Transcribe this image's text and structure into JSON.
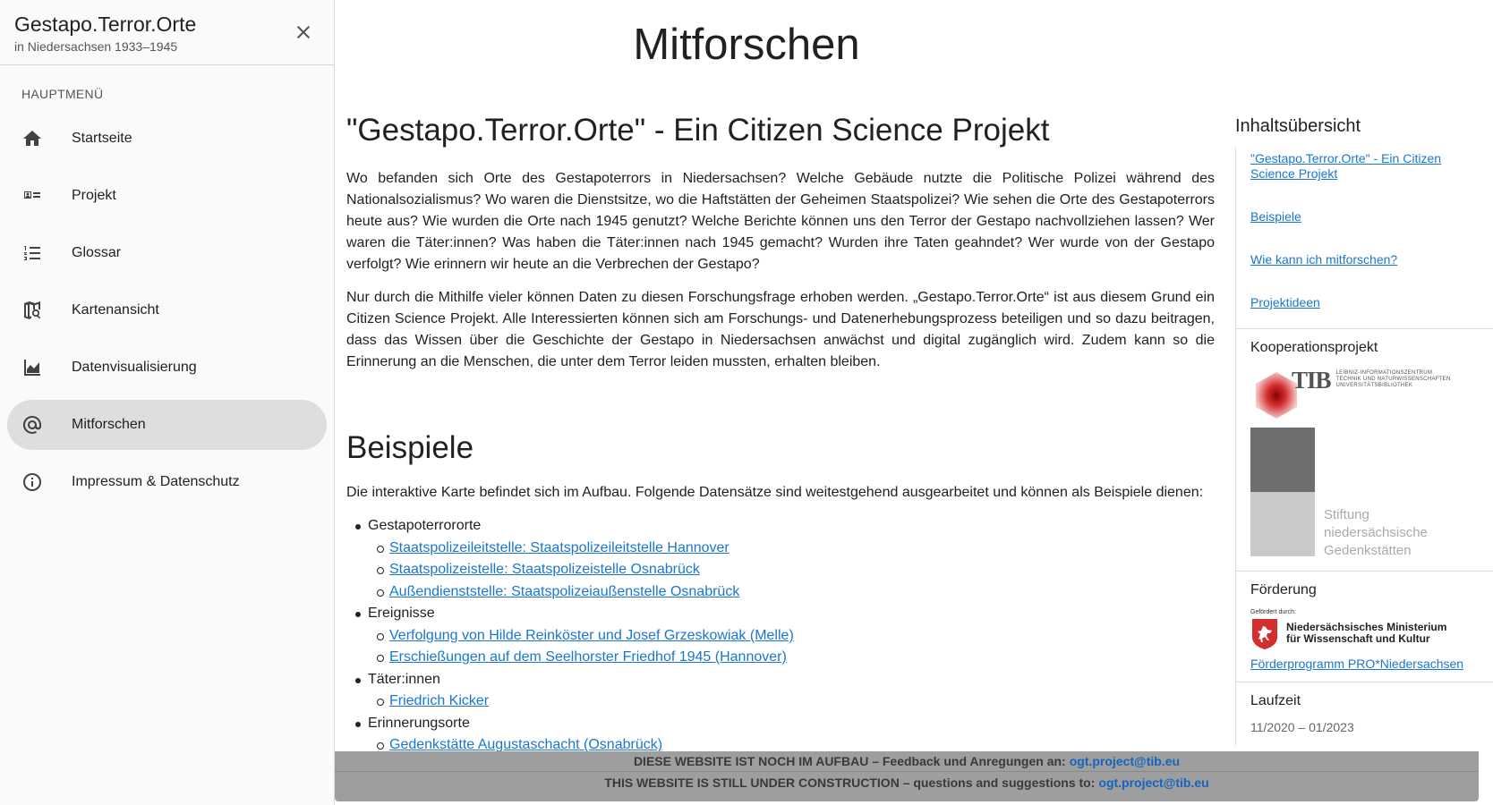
{
  "sidebar": {
    "title": "Gestapo.Terror.Orte",
    "subtitle": "in Niedersachsen 1933–1945",
    "menu_title": "HAUPTMENÜ",
    "items": [
      {
        "label": "Startseite",
        "icon": "home-icon"
      },
      {
        "label": "Projekt",
        "icon": "card-text-icon"
      },
      {
        "label": "Glossar",
        "icon": "numbered-list-icon"
      },
      {
        "label": "Kartenansicht",
        "icon": "map-search-icon"
      },
      {
        "label": "Datenvisualisierung",
        "icon": "area-chart-icon"
      },
      {
        "label": "Mitforschen",
        "icon": "at-sign-icon",
        "active": true
      },
      {
        "label": "Impressum & Datenschutz",
        "icon": "info-icon"
      }
    ]
  },
  "main": {
    "page_title": "Mitforschen",
    "section1": {
      "heading": "\"Gestapo.Terror.Orte\" - Ein Citizen Science Projekt",
      "p1": "Wo befanden sich Orte des Gestapoterrors in Niedersachsen? Welche Gebäude nutzte die Politische Polizei während des Nationalsozialismus? Wo waren die Dienstsitze, wo die Haftstätten der Geheimen Staatspolizei? Wie sehen die Orte des Gestapoterrors heute aus? Wie wurden die Orte nach 1945 genutzt? Welche Berichte können uns den Terror der Gestapo nachvollziehen lassen? Wer waren die Täter:innen? Was haben die Täter:innen nach 1945 gemacht? Wurden ihre Taten geahndet? Wer wurde von der Gestapo verfolgt? Wie erinnern wir heute an die Verbrechen der Gestapo?",
      "p2": "Nur durch die Mithilfe vieler können Daten zu diesen Forschungsfrage erhoben werden. „Gestapo.Terror.Orte“ ist aus diesem Grund ein Citizen Science Projekt. Alle Interessierten können sich am Forschungs- und Datenerhebungsprozess beteiligen und so dazu beitragen, dass das Wissen über die Geschichte der Gestapo in Niedersachsen anwächst und digital zugänglich wird. Zudem kann so die Erinnerung an die Menschen, die unter dem Terror leiden mussten, erhalten bleiben."
    },
    "section2": {
      "heading": "Beispiele",
      "intro": "Die interaktive Karte befindet sich im Aufbau. Folgende Datensätze sind weitestgehend ausgearbeitet und können als Beispiele dienen:",
      "categories": [
        {
          "label": "Gestapoterrororte",
          "links": [
            "Staatspolizeileitstelle: Staatspolizeileitstelle Hannover",
            "Staatspolizeistelle: Staatspolizeistelle Osnabrück",
            "Außendienststelle: Staatspolizeiaußenstelle Osnabrück"
          ]
        },
        {
          "label": "Ereignisse",
          "links": [
            "Verfolgung von Hilde Reinköster und Josef Grzeskowiak (Melle)",
            "Erschießungen auf dem Seelhorster Friedhof 1945 (Hannover)"
          ]
        },
        {
          "label": "Täter:innen",
          "links": [
            "Friedrich Kicker"
          ]
        },
        {
          "label": "Erinnerungsorte",
          "links": [
            "Gedenkstätte Augustaschacht (Osnabrück)"
          ]
        }
      ]
    }
  },
  "right": {
    "toc_title": "Inhaltsübersicht",
    "toc_links": [
      "\"Gestapo.Terror.Orte\" - Ein Citizen Science Projekt",
      "Beispiele",
      "Wie kann ich mitforschen?",
      "Projektideen"
    ],
    "kooperation": {
      "heading": "Kooperationsprojekt",
      "tib_logo": "TIB",
      "tib_small": [
        "Leibniz-Informationszentrum",
        "Technik und Naturwissenschaften",
        "Universitätsbibliothek"
      ],
      "stiftung": [
        "Stiftung",
        "niedersächsische",
        "Gedenkstätten"
      ]
    },
    "foerderung": {
      "heading": "Förderung",
      "small": "Gefördert durch:",
      "ministry": [
        "Niedersächsisches Ministerium",
        "für Wissenschaft und Kultur"
      ],
      "link": "Förderprogramm PRO*Niedersachsen"
    },
    "laufzeit": {
      "heading": "Laufzeit",
      "value": "11/2020 – 01/2023"
    }
  },
  "banner": {
    "de_text": "DIESE WEBSITE IST NOCH IM AUFBAU – Feedback und Anregungen an:",
    "en_text": "THIS WEBSITE IS STILL UNDER CONSTRUCTION – questions and suggestions to:",
    "email": "ogt.project@tib.eu"
  }
}
